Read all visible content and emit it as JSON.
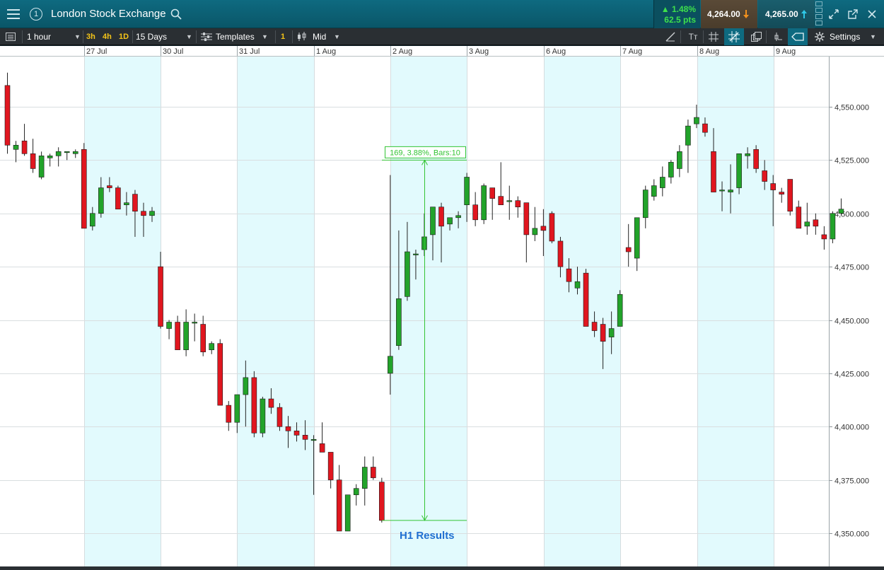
{
  "header": {
    "title": "London Stock Exchange",
    "change_pct": "▲ 1.48%",
    "change_pts": "62.5 pts",
    "bid": "4,264.00",
    "ask": "4,265.00",
    "menu_icon": "hamburger-icon",
    "layout_number": "1"
  },
  "toolbar": {
    "interval": "1 hour",
    "quick_3h": "3h",
    "quick_4h": "4h",
    "quick_1d": "1D",
    "range": "15 Days",
    "templates": "Templates",
    "badge": "1",
    "price_type": "Mid",
    "settings": "Settings",
    "text_tool": "Tт"
  },
  "colors": {
    "up": "#22a32a",
    "down": "#e0161f",
    "band": "#e2fafd",
    "measure": "#33c433",
    "annotation": "#1f6fd1"
  },
  "chart_data": {
    "type": "candlestick",
    "yaxis_ticks": [
      "4,550.000",
      "4,525.000",
      "4,500.000",
      "4,475.000",
      "4,450.000",
      "4,425.000",
      "4,400.000",
      "4,375.000",
      "4,350.000"
    ],
    "ylim": [
      4342,
      4572
    ],
    "date_labels": [
      "27 Jul",
      "30 Jul",
      "31 Jul",
      "1 Aug",
      "2 Aug",
      "3 Aug",
      "6 Aug",
      "7 Aug",
      "8 Aug",
      "9 Aug"
    ],
    "measure_label": "169, 3.88%, Bars:10",
    "measure_from": 4356,
    "measure_to": 4525,
    "annotation": "H1 Results",
    "candles": [
      [
        4560,
        4566,
        4528,
        4532
      ],
      [
        4530,
        4534,
        4524,
        4532
      ],
      [
        4534,
        4542,
        4527,
        4528
      ],
      [
        4528,
        4535,
        4519,
        4521
      ],
      [
        4517,
        4529,
        4516,
        4527
      ],
      [
        4526,
        4528,
        4522,
        4527
      ],
      [
        4527,
        4531,
        4522,
        4529
      ],
      [
        4529,
        4529,
        4525,
        4529
      ],
      [
        4528,
        4530,
        4526,
        4529
      ],
      [
        4530,
        4533,
        4493,
        4493
      ],
      [
        4494,
        4503,
        4492,
        4500
      ],
      [
        4500,
        4517,
        4498,
        4512
      ],
      [
        4513,
        4517,
        4510,
        4512
      ],
      [
        4512,
        4513,
        4502,
        4502
      ],
      [
        4504,
        4510,
        4499,
        4505
      ],
      [
        4509,
        4511,
        4489,
        4501
      ],
      [
        4501,
        4505,
        4489,
        4499
      ],
      [
        4499,
        4503,
        4496,
        4501
      ],
      [
        4475,
        4482,
        4446,
        4447
      ],
      [
        4446,
        4450,
        4441,
        4449
      ],
      [
        4449,
        4452,
        4437,
        4436
      ],
      [
        4436,
        4455,
        4433,
        4449
      ],
      [
        4449,
        4453,
        4440,
        4449
      ],
      [
        4448,
        4452,
        4433,
        4435
      ],
      [
        4436,
        4440,
        4434,
        4439
      ],
      [
        4439,
        4441,
        4410,
        4410
      ],
      [
        4410,
        4412,
        4398,
        4402
      ],
      [
        4402,
        4415,
        4397,
        4415
      ],
      [
        4415,
        4431,
        4400,
        4423
      ],
      [
        4423,
        4426,
        4395,
        4397
      ],
      [
        4397,
        4414,
        4395,
        4413
      ],
      [
        4413,
        4418,
        4406,
        4409
      ],
      [
        4409,
        4411,
        4398,
        4400
      ],
      [
        4400,
        4405,
        4390,
        4398
      ],
      [
        4398,
        4402,
        4393,
        4396
      ],
      [
        4396,
        4403,
        4389,
        4394
      ],
      [
        4394,
        4396,
        4368,
        4394
      ],
      [
        4392,
        4402,
        4388,
        4388
      ],
      [
        4388,
        4388,
        4371,
        4375
      ],
      [
        4375,
        4382,
        4351,
        4351
      ],
      [
        4351,
        4367,
        4352,
        4368
      ],
      [
        4368,
        4373,
        4363,
        4371
      ],
      [
        4371,
        4386,
        4363,
        4381
      ],
      [
        4381,
        4386,
        4375,
        4376
      ],
      [
        4374,
        4376,
        4355,
        4356
      ],
      [
        4425,
        4518,
        4415,
        4433
      ],
      [
        4438,
        4492,
        4436,
        4460
      ],
      [
        4461,
        4496,
        4459,
        4482
      ],
      [
        4481,
        4483,
        4469,
        4481
      ],
      [
        4483,
        4500,
        4480,
        4489
      ],
      [
        4490,
        4503,
        4478,
        4503
      ],
      [
        4503,
        4505,
        4477,
        4494
      ],
      [
        4495,
        4497,
        4492,
        4498
      ],
      [
        4498,
        4501,
        4493,
        4499
      ],
      [
        4504,
        4519,
        4496,
        4517
      ],
      [
        4504,
        4510,
        4494,
        4497
      ],
      [
        4497,
        4514,
        4495,
        4513
      ],
      [
        4512,
        4512,
        4497,
        4507
      ],
      [
        4508,
        4524,
        4505,
        4504
      ],
      [
        4506,
        4513,
        4497,
        4506
      ],
      [
        4506,
        4508,
        4498,
        4503
      ],
      [
        4505,
        4505,
        4477,
        4490
      ],
      [
        4490,
        4503,
        4487,
        4493
      ],
      [
        4494,
        4502,
        4480,
        4492
      ],
      [
        4500,
        4501,
        4486,
        4487
      ],
      [
        4487,
        4489,
        4470,
        4475
      ],
      [
        4474,
        4479,
        4463,
        4468
      ],
      [
        4465,
        4475,
        4462,
        4468
      ],
      [
        4472,
        4474,
        4448,
        4447
      ],
      [
        4449,
        4454,
        4442,
        4445
      ],
      [
        4448,
        4451,
        4427,
        4440
      ],
      [
        4442,
        4454,
        4434,
        4446
      ],
      [
        4447,
        4464,
        4449,
        4462
      ],
      [
        4484,
        4495,
        4475,
        4482
      ],
      [
        4479,
        4497,
        4473,
        4498
      ],
      [
        4498,
        4513,
        4493,
        4511
      ],
      [
        4508,
        4516,
        4506,
        4513
      ],
      [
        4512,
        4522,
        4508,
        4517
      ],
      [
        4517,
        4525,
        4514,
        4524
      ],
      [
        4521,
        4532,
        4517,
        4529
      ],
      [
        4532,
        4544,
        4519,
        4541
      ],
      [
        4542,
        4551,
        4540,
        4545
      ],
      [
        4542,
        4545,
        4536,
        4538
      ],
      [
        4529,
        4540,
        4510,
        4510
      ],
      [
        4511,
        4515,
        4501,
        4511
      ],
      [
        4510,
        4523,
        4500,
        4511
      ],
      [
        4512,
        4528,
        4509,
        4528
      ],
      [
        4527,
        4531,
        4521,
        4528
      ],
      [
        4530,
        4532,
        4519,
        4521
      ],
      [
        4520,
        4525,
        4511,
        4515
      ],
      [
        4514,
        4518,
        4494,
        4511
      ],
      [
        4510,
        4512,
        4505,
        4509
      ],
      [
        4516,
        4516,
        4499,
        4501
      ],
      [
        4503,
        4506,
        4496,
        4493
      ],
      [
        4494,
        4505,
        4490,
        4496
      ],
      [
        4497,
        4500,
        4490,
        4494
      ],
      [
        4490,
        4494,
        4483,
        4488
      ],
      [
        4488,
        4501,
        4486,
        4500
      ],
      [
        4500,
        4507,
        4499,
        4502
      ]
    ]
  }
}
